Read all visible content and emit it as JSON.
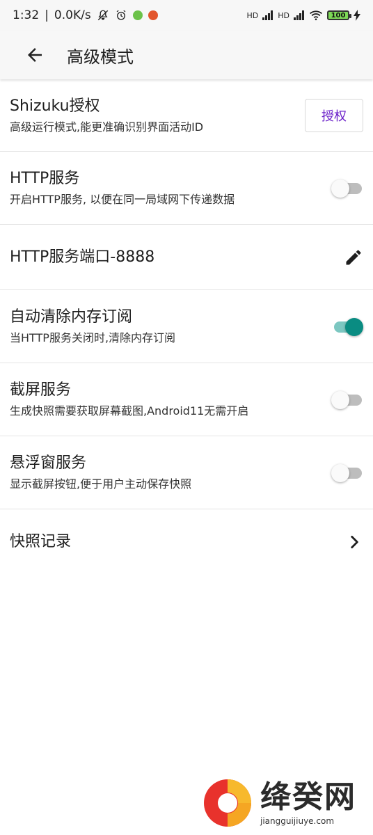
{
  "status_bar": {
    "time": "1:32",
    "network_speed": "0.0K/s",
    "battery_level": "100",
    "hd1": "HD",
    "hd2": "HD"
  },
  "app_bar": {
    "title": "高级模式"
  },
  "settings": {
    "shizuku": {
      "title": "Shizuku授权",
      "subtitle": "高级运行模式,能更准确识别界面活动ID",
      "button_label": "授权"
    },
    "http_service": {
      "title": "HTTP服务",
      "subtitle": "开启HTTP服务, 以便在同一局域网下传递数据",
      "enabled": false
    },
    "http_port": {
      "title": "HTTP服务端口-8888"
    },
    "auto_clear": {
      "title": "自动清除内存订阅",
      "subtitle": "当HTTP服务关闭时,清除内存订阅",
      "enabled": true
    },
    "screenshot_service": {
      "title": "截屏服务",
      "subtitle": "生成快照需要获取屏幕截图,Android11无需开启",
      "enabled": false
    },
    "floating_window": {
      "title": "悬浮窗服务",
      "subtitle": "显示截屏按钮,便于用户主动保存快照",
      "enabled": false
    },
    "snapshot_records": {
      "title": "快照记录"
    }
  },
  "watermark": {
    "name": "绛癸网",
    "url": "jiangguijiuye.com"
  },
  "colors": {
    "accent": "#0a8c82",
    "accent_track": "#7cc7c1",
    "button_text": "#6a1fc9"
  }
}
